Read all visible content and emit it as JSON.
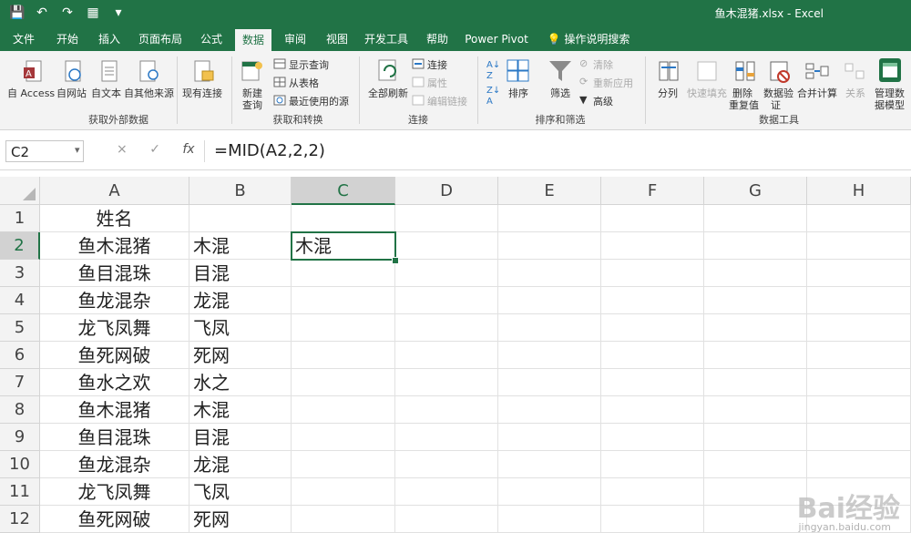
{
  "window": {
    "title": "鱼木混猪.xlsx  -  Excel"
  },
  "qat": {
    "save": "💾",
    "undo": "↶",
    "redo": "↷",
    "form": "▦",
    "more": "▾"
  },
  "tabs": [
    "文件",
    "开始",
    "插入",
    "页面布局",
    "公式",
    "数据",
    "审阅",
    "视图",
    "开发工具",
    "帮助",
    "Power Pivot",
    "操作说明搜索"
  ],
  "ribbon": {
    "get_external": {
      "items": [
        "自 Access",
        "自网站",
        "自文本",
        "自其他来源",
        "现有连接"
      ],
      "label": "获取外部数据"
    },
    "get_transform": {
      "new_query": "新建",
      "new_query2": "查询",
      "show_query": "显示查询",
      "from_table": "从表格",
      "recent_sources": "最近使用的源",
      "label": "获取和转换"
    },
    "connections": {
      "refresh_all": "全部刷新",
      "connections": "连接",
      "properties": "属性",
      "edit_links": "编辑链接",
      "label": "连接"
    },
    "sort_filter": {
      "sort": "排序",
      "filter": "筛选",
      "clear": "清除",
      "reapply": "重新应用",
      "advanced": "高级",
      "label": "排序和筛选"
    },
    "data_tools": {
      "text_to_columns": "分列",
      "flash_fill": "快速填充",
      "remove_dup": "删除",
      "remove_dup2": "重复值",
      "validation": "数据验",
      "validation2": "证",
      "consolidate": "合并计算",
      "relationships": "关系",
      "manage_model": "管理数",
      "manage_model2": "据模型",
      "label": "数据工具"
    }
  },
  "formula_bar": {
    "name_box": "C2",
    "formula": "=MID(A2,2,2)",
    "cancel": "×",
    "enter": "✓",
    "fx": "fx"
  },
  "sheet": {
    "columns": [
      "A",
      "B",
      "C",
      "D",
      "E",
      "F",
      "G",
      "H"
    ],
    "rows": [
      "1",
      "2",
      "3",
      "4",
      "5",
      "6",
      "7",
      "8",
      "9",
      "10",
      "11",
      "12"
    ],
    "colA": [
      "姓名",
      "鱼木混猪",
      "鱼目混珠",
      "鱼龙混杂",
      "龙飞凤舞",
      "鱼死网破",
      "鱼水之欢",
      "鱼木混猪",
      "鱼目混珠",
      "鱼龙混杂",
      "龙飞凤舞",
      "鱼死网破"
    ],
    "colB": [
      "",
      "木混",
      "目混",
      "龙混",
      "飞凤",
      "死网",
      "水之",
      "木混",
      "目混",
      "龙混",
      "飞凤",
      "死网"
    ],
    "colC": [
      "",
      "木混",
      "",
      "",
      "",
      "",
      "",
      "",
      "",
      "",
      "",
      ""
    ],
    "active_cell": "C2"
  },
  "watermark": {
    "text": "Bai经验",
    "sub": "jingyan.baidu.com"
  }
}
